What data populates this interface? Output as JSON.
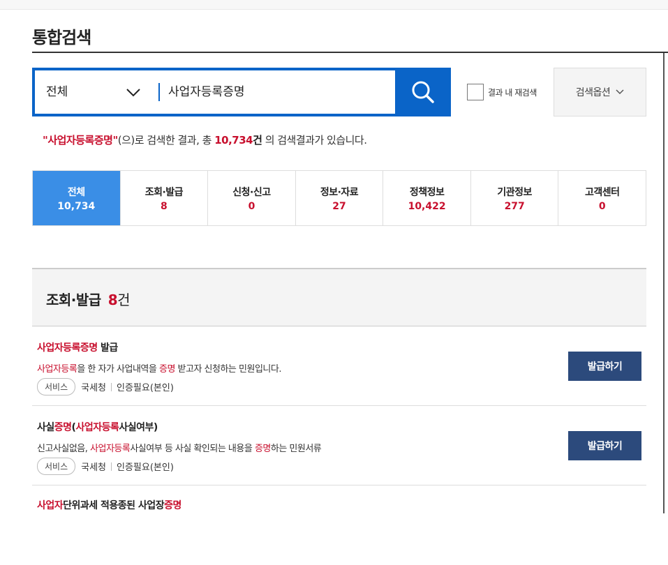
{
  "page": {
    "title": "통합검색"
  },
  "search": {
    "scope_label": "전체",
    "query": "사업자등록증명",
    "within_results_label": "결과 내 재검색",
    "options_label": "검색옵션"
  },
  "summary": {
    "quote_open": "\"",
    "keyword": "사업자등록증명",
    "quote_close": "\"",
    "text_before": "(으)로 검색한 결과, 총 ",
    "count": "10,734",
    "unit": "건",
    "text_after": " 의 검색결과가 있습니다."
  },
  "tabs": [
    {
      "label": "전체",
      "count": "10,734"
    },
    {
      "label": "조회·발급",
      "count": "8"
    },
    {
      "label": "신청·신고",
      "count": "0"
    },
    {
      "label": "정보·자료",
      "count": "27"
    },
    {
      "label": "정책정보",
      "count": "10,422"
    },
    {
      "label": "기관정보",
      "count": "277"
    },
    {
      "label": "고객센터",
      "count": "0"
    }
  ],
  "section": {
    "title": "조회·발급",
    "count": "8",
    "unit": "건"
  },
  "results": [
    {
      "title_hl": "사업자등록증명",
      "title_rest": " 발급",
      "desc_hl1": "사업자등록",
      "desc_mid": "을 한 자가 사업내역을 ",
      "desc_hl2": "증명",
      "desc_rest": " 받고자 신청하는 민원입니다.",
      "tag": "서비스",
      "agency": "국세청",
      "auth": "인증필요(본인)",
      "button": "발급하기"
    },
    {
      "title_pre": "사실",
      "title_hl1": "증명",
      "title_mid": "(",
      "title_hl2": "사업자등록",
      "title_rest": "사실여부)",
      "desc_pre": "신고사실없음, ",
      "desc_hl1": "사업자등록",
      "desc_mid": "사실여부 등 사실 확인되는 내용을 ",
      "desc_hl2": "증명",
      "desc_rest": "하는 민원서류",
      "tag": "서비스",
      "agency": "국세청",
      "auth": "인증필요(본인)",
      "button": "발급하기"
    },
    {
      "title_hl1": "사업자",
      "title_mid": "단위과세 적용종된 사업장",
      "title_hl2": "증명"
    }
  ]
}
